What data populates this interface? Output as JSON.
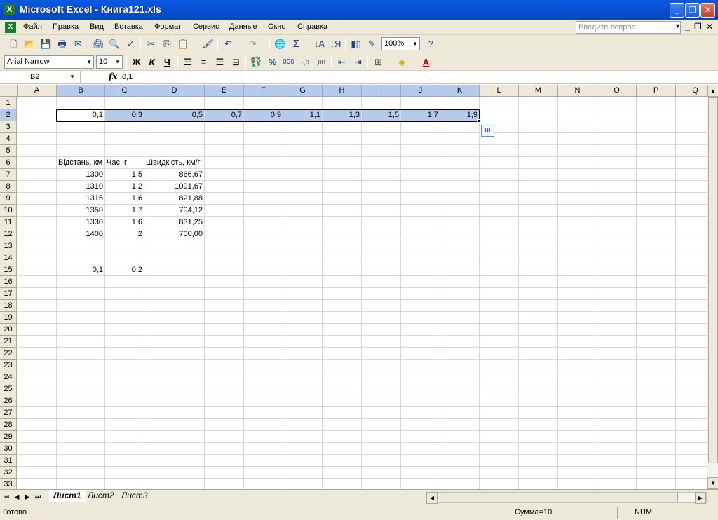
{
  "window": {
    "title": "Microsoft Excel - Книга121.xls",
    "app_icon": "excel-icon",
    "minimize": "_",
    "restore": "❐",
    "close": "✕"
  },
  "menu": {
    "items": [
      "Файл",
      "Правка",
      "Вид",
      "Вставка",
      "Формат",
      "Сервис",
      "Данные",
      "Окно",
      "Справка"
    ],
    "ask_placeholder": "Введите вопрос",
    "doc_min": "_",
    "doc_restore": "❐",
    "doc_close": "✕"
  },
  "toolbar": {
    "zoom": "100%",
    "font_name": "Arial Narrow",
    "font_size": "10",
    "bold": "Ж",
    "italic": "К",
    "underline": "Ч",
    "autosum": "Σ",
    "percent": "%",
    "thousands": "000",
    "inc_decimal": "+,0",
    "dec_decimal": ",00"
  },
  "formula_bar": {
    "name_box": "B2",
    "fx": "fx",
    "value": "0,1"
  },
  "columns": [
    "A",
    "B",
    "C",
    "D",
    "E",
    "F",
    "G",
    "H",
    "I",
    "J",
    "K",
    "L",
    "M",
    "N",
    "O",
    "P",
    "Q"
  ],
  "rows": [
    "1",
    "2",
    "3",
    "4",
    "5",
    "6",
    "7",
    "8",
    "9",
    "10",
    "11",
    "12",
    "13",
    "14",
    "15",
    "16",
    "17",
    "18",
    "19",
    "20",
    "21",
    "22",
    "23",
    "24",
    "25",
    "26",
    "27",
    "28",
    "29",
    "30",
    "31",
    "32",
    "33"
  ],
  "cells": {
    "row2": [
      "0,1",
      "0,3",
      "0,5",
      "0,7",
      "0,9",
      "1,1",
      "1,3",
      "1,5",
      "1,7",
      "1,9"
    ],
    "headers6": [
      "Відстань, км",
      "Час, г",
      "Швидкість, км/г"
    ],
    "table": [
      [
        "1300",
        "1,5",
        "866,67"
      ],
      [
        "1310",
        "1,2",
        "1091,67"
      ],
      [
        "1315",
        "1,6",
        "821,88"
      ],
      [
        "1350",
        "1,7",
        "794,12"
      ],
      [
        "1330",
        "1,6",
        "831,25"
      ],
      [
        "1400",
        "2",
        "700,00"
      ]
    ],
    "row15": [
      "0,1",
      "0,2"
    ]
  },
  "sheets": [
    "Лист1",
    "Лист2",
    "Лист3"
  ],
  "active_sheet": "Лист1",
  "status": {
    "ready": "Готово",
    "sum": "Сумма=10",
    "num": "NUM"
  },
  "colors": {
    "selection": "#b6caea",
    "title_bar": "#0a4fd8",
    "chrome": "#ece9d8"
  }
}
